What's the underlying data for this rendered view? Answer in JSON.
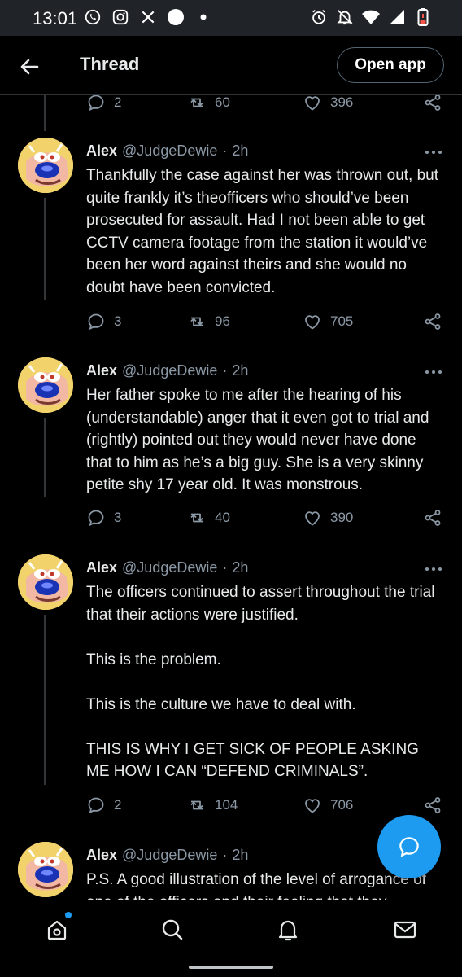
{
  "status_bar": {
    "time": "13:01",
    "left_icons": [
      "whatsapp-icon",
      "instagram-icon",
      "x-icon",
      "circle-icon",
      "dot-icon"
    ],
    "right_icons": [
      "alarm-icon",
      "notifications-off-icon",
      "wifi-icon",
      "signal-icon",
      "battery-low-icon"
    ]
  },
  "header": {
    "title": "Thread",
    "open_app_label": "Open app"
  },
  "top_actions": {
    "replies": "2",
    "retweets": "60",
    "likes": "396"
  },
  "tweets": [
    {
      "name": "Alex",
      "handle": "@JudgeDewie",
      "dot": "·",
      "time": "2h",
      "text": [
        "Thankfully the case against her was thrown out, but quite frankly it’s theofficers who should’ve been prosecuted for assault. Had I not been able to get CCTV camera footage from the station it would’ve been her word against theirs and she would no doubt have been convicted."
      ],
      "replies": "3",
      "retweets": "96",
      "likes": "705"
    },
    {
      "name": "Alex",
      "handle": "@JudgeDewie",
      "dot": "·",
      "time": "2h",
      "text": [
        "Her father spoke to me after the hearing of his (understandable) anger that it even got to trial and (rightly) pointed out they would never have done that to him as he’s a big guy. She is a very skinny petite shy 17 year old. It was monstrous."
      ],
      "replies": "3",
      "retweets": "40",
      "likes": "390"
    },
    {
      "name": "Alex",
      "handle": "@JudgeDewie",
      "dot": "·",
      "time": "2h",
      "text": [
        "The officers continued to assert throughout the trial that their actions were justified.",
        "This is the problem.",
        "This is the culture we have to deal with.",
        "THIS IS WHY I GET SICK OF PEOPLE ASKING ME HOW I CAN “DEFEND CRIMINALS”."
      ],
      "replies": "2",
      "retweets": "104",
      "likes": "706"
    },
    {
      "name": "Alex",
      "handle": "@JudgeDewie",
      "dot": "·",
      "time": "2h",
      "text": [
        "P.S. A good illustration of the level of arrogance of one of the officers and their feeling that they"
      ],
      "replies": "",
      "retweets": "",
      "likes": ""
    }
  ],
  "colors": {
    "background": "#000000",
    "accent": "#1d9bf0",
    "muted": "#8b98a5",
    "text": "#e7e9ea"
  },
  "bottom_nav": [
    "home-icon",
    "search-icon",
    "notifications-icon",
    "messages-icon"
  ]
}
